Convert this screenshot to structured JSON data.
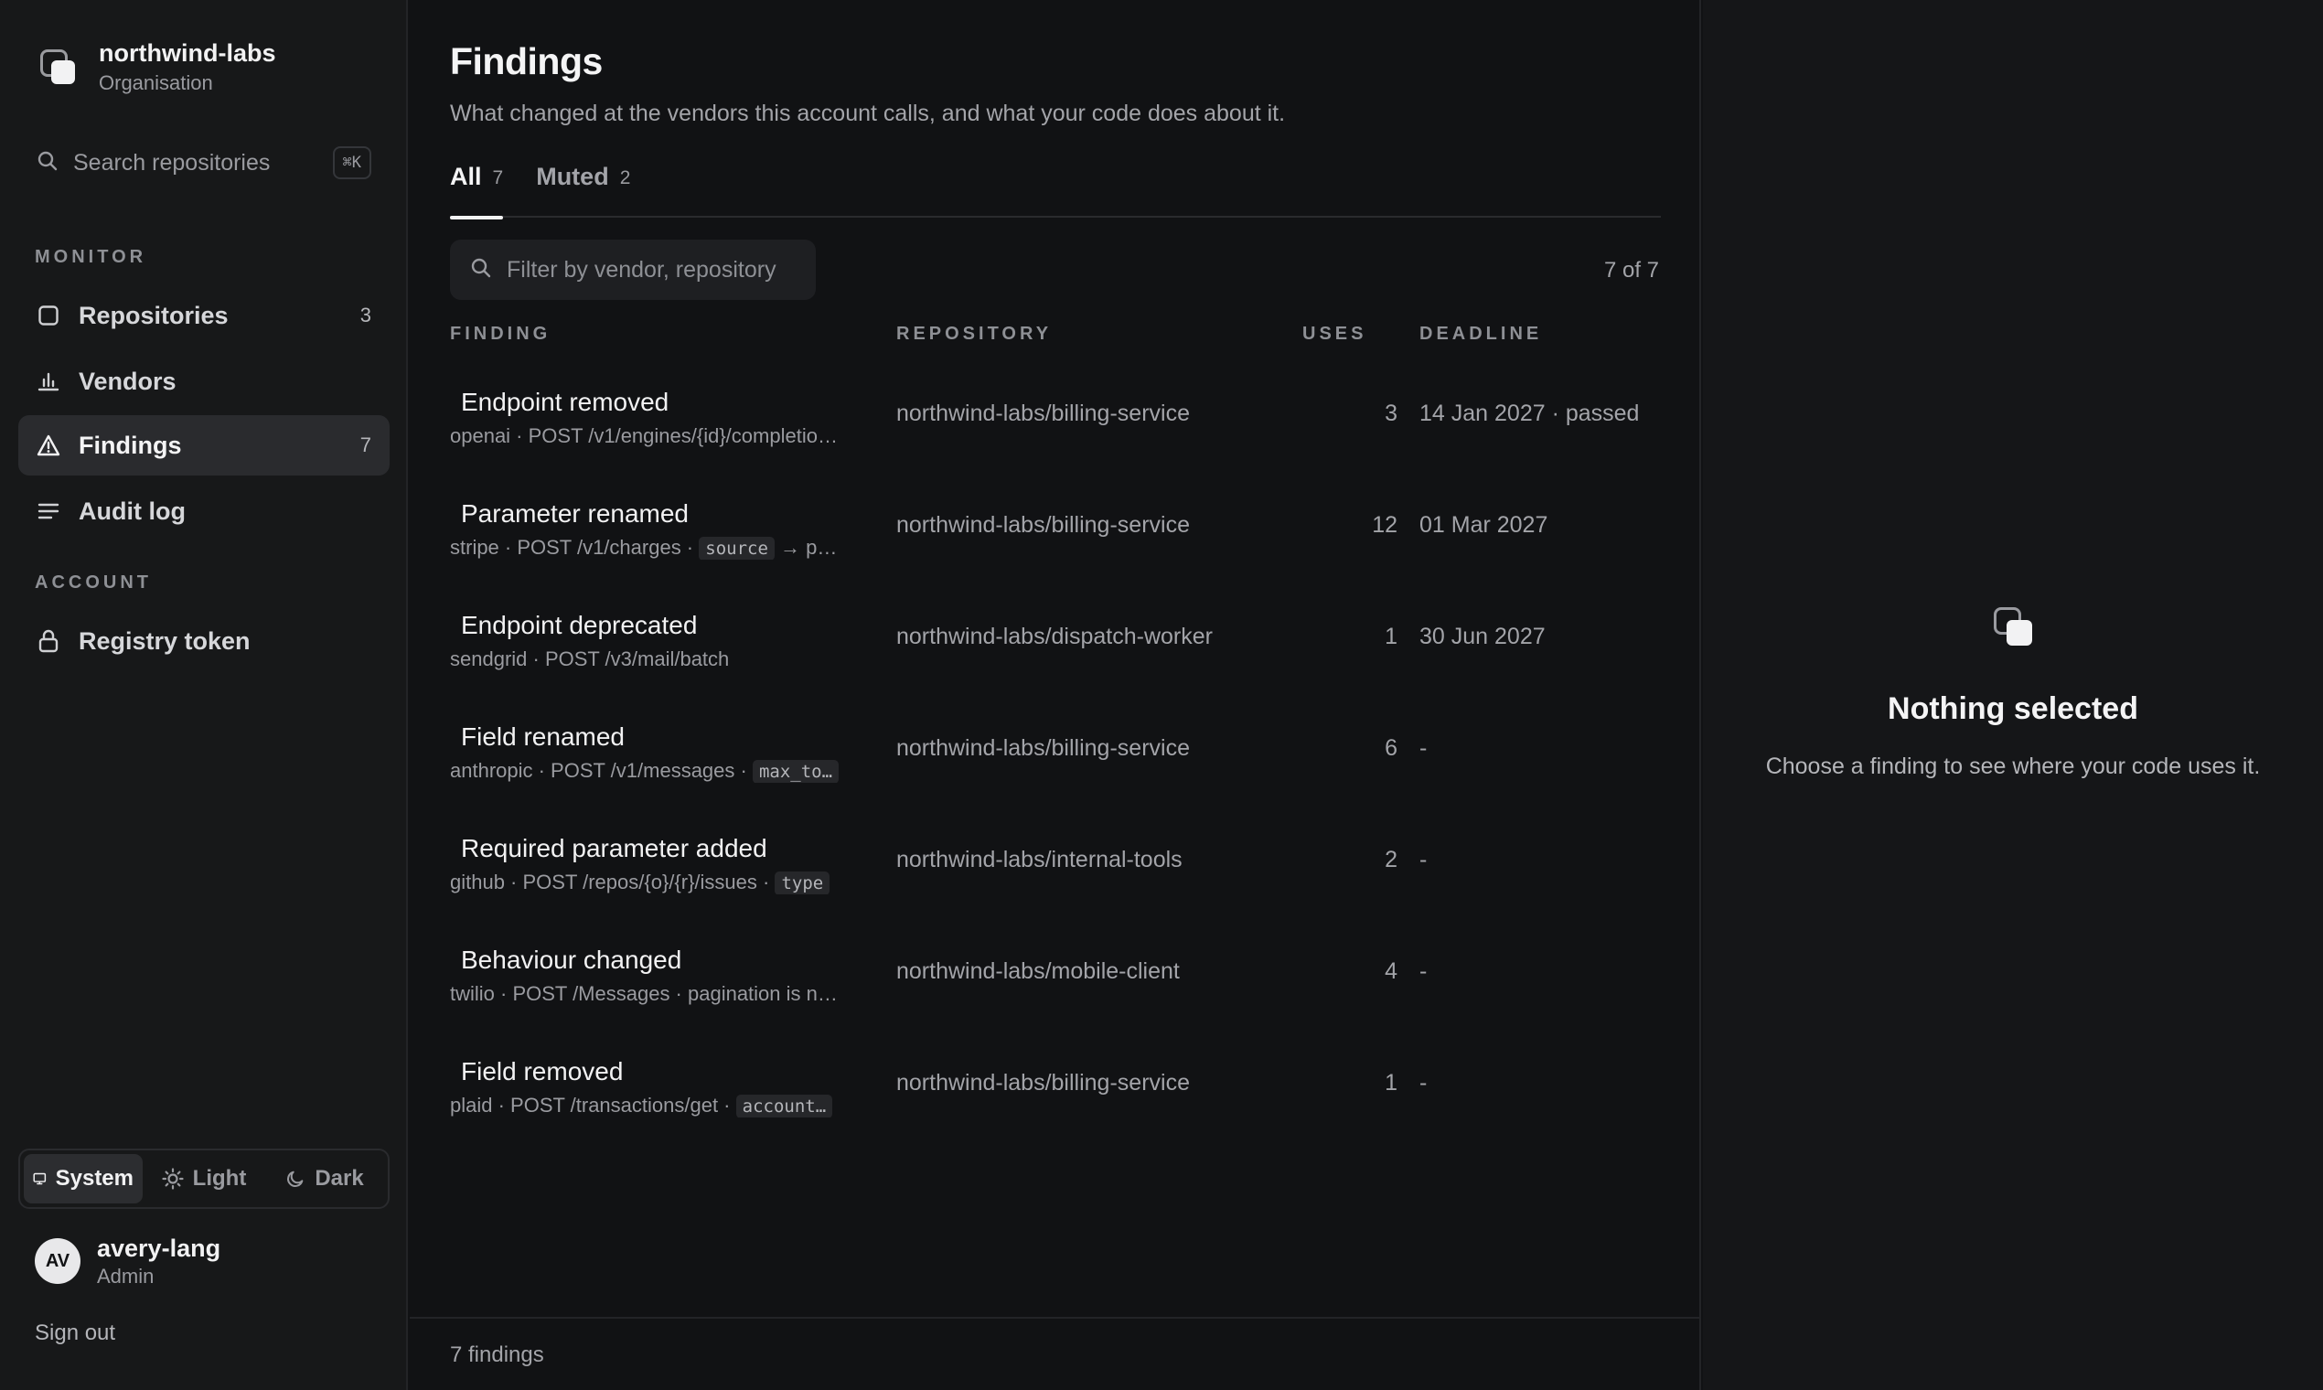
{
  "org": {
    "name": "northwind-labs",
    "subtitle": "Organisation"
  },
  "search": {
    "label": "Search repositories",
    "shortcut": "⌘K"
  },
  "nav": {
    "monitor_title": "MONITOR",
    "account_title": "ACCOUNT",
    "items": [
      {
        "label": "Repositories",
        "count": "3",
        "icon": "square-icon"
      },
      {
        "label": "Vendors",
        "count": "",
        "icon": "bar-chart-icon"
      },
      {
        "label": "Findings",
        "count": "7",
        "icon": "warning-triangle-icon",
        "active": true
      },
      {
        "label": "Audit log",
        "count": "",
        "icon": "list-icon"
      },
      {
        "label": "Registry token",
        "count": "",
        "icon": "lock-icon"
      }
    ]
  },
  "theme": {
    "options": [
      "System",
      "Light",
      "Dark"
    ],
    "selected": "System"
  },
  "user": {
    "initials": "AV",
    "name": "avery-lang",
    "role": "Admin"
  },
  "signout": "Sign out",
  "page": {
    "title": "Findings",
    "subtitle": "What changed at the vendors this account calls, and what your code does about it."
  },
  "tabs": [
    {
      "label": "All",
      "count": "7",
      "active": true
    },
    {
      "label": "Muted",
      "count": "2",
      "active": false
    }
  ],
  "filter": {
    "placeholder": "Filter by vendor, repository"
  },
  "result_count": "7 of 7",
  "table": {
    "headers": {
      "finding": "FINDING",
      "repository": "REPOSITORY",
      "uses": "USES",
      "deadline": "DEADLINE"
    },
    "rows": [
      {
        "title": "Endpoint removed",
        "sub_text": "openai · POST /v1/engines/{id}/completio…",
        "sub_code": "",
        "repo": "northwind-labs/billing-service",
        "uses": "3",
        "deadline": "14 Jan 2027 · passed"
      },
      {
        "title": "Parameter renamed",
        "sub_text": "stripe · POST /v1/charges · ",
        "sub_code": "source",
        "sub_after": " → p…",
        "repo": "northwind-labs/billing-service",
        "uses": "12",
        "deadline": "01 Mar 2027"
      },
      {
        "title": "Endpoint deprecated",
        "sub_text": "sendgrid · POST /v3/mail/batch",
        "sub_code": "",
        "repo": "northwind-labs/dispatch-worker",
        "uses": "1",
        "deadline": "30 Jun 2027"
      },
      {
        "title": "Field renamed",
        "sub_text": "anthropic · POST /v1/messages · ",
        "sub_code": "max_to…",
        "repo": "northwind-labs/billing-service",
        "uses": "6",
        "deadline": "-"
      },
      {
        "title": "Required parameter added",
        "sub_text": "github · POST /repos/{o}/{r}/issues · ",
        "sub_code": "type",
        "repo": "northwind-labs/internal-tools",
        "uses": "2",
        "deadline": "-"
      },
      {
        "title": "Behaviour changed",
        "sub_text": "twilio · POST /Messages · pagination is n…",
        "sub_code": "",
        "repo": "northwind-labs/mobile-client",
        "uses": "4",
        "deadline": "-"
      },
      {
        "title": "Field removed",
        "sub_text": "plaid · POST /transactions/get · ",
        "sub_code": "account…",
        "repo": "northwind-labs/billing-service",
        "uses": "1",
        "deadline": "-"
      }
    ]
  },
  "footer": "7 findings",
  "detail": {
    "empty_title": "Nothing selected",
    "empty_sub": "Choose a finding to see where your code uses it."
  }
}
